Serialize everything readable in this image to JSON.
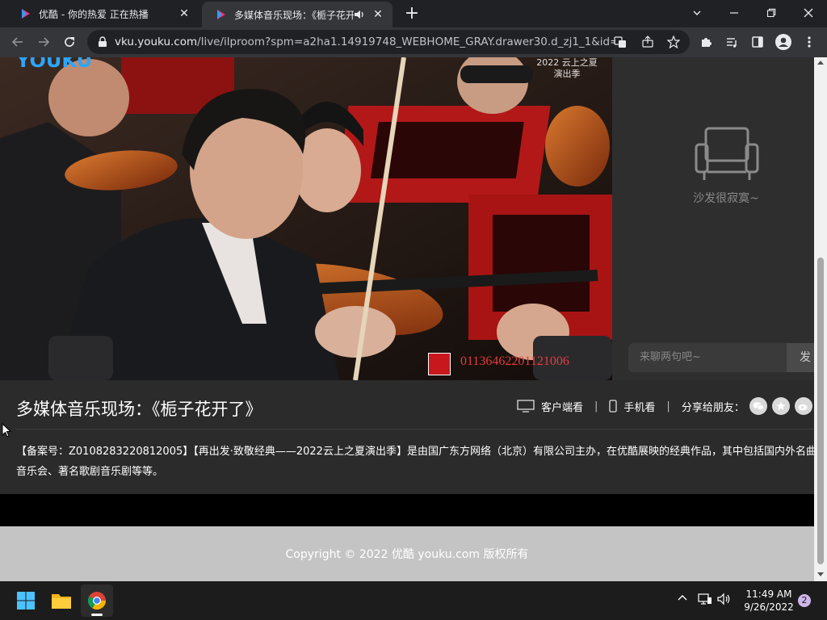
{
  "browser": {
    "tabs": [
      {
        "title": "优酷 - 你的热爱 正在热播",
        "active": false
      },
      {
        "title": "多媒体音乐现场：《栀子花开",
        "active": true,
        "playing_audio": true
      }
    ],
    "url_host": "vku.youku.com",
    "url_path": "/live/ilproom?spm=a2ha1.14919748_WEBHOME_GRAY.drawer30.d_zj1_1&id=814..."
  },
  "video": {
    "watermark_top": "2022 云上之夏 演出季",
    "watermark_number": "01136462201121006",
    "logo_text": "YOUKU"
  },
  "side": {
    "empty_text": "沙发很寂寞~",
    "chat_placeholder": "来聊两句吧~",
    "send_label": "发"
  },
  "info": {
    "title": "多媒体音乐现场：《栀子花开了》",
    "client_watch": "客户端看",
    "phone_watch": "手机看",
    "share_label": "分享给朋友：",
    "description": "【备案号：Z0108283220812005】【再出发·致敬经典——2022云上之夏演出季】是由国广东方网络（北京）有限公司主办，在优酷展映的经典作品，其中包括国内外名曲音乐会、著名歌剧音乐剧等等。"
  },
  "footer": {
    "copyright": "Copyright © 2022 优酷 youku.com 版权所有"
  },
  "taskbar": {
    "time": "11:49 AM",
    "date": "9/26/2022",
    "notifications": "2"
  },
  "colors": {
    "page_bg": "#2b2b2b",
    "footer_bg": "#c4c4c4",
    "chrome_dark": "#202124",
    "chrome_toolbar": "#35363a"
  }
}
